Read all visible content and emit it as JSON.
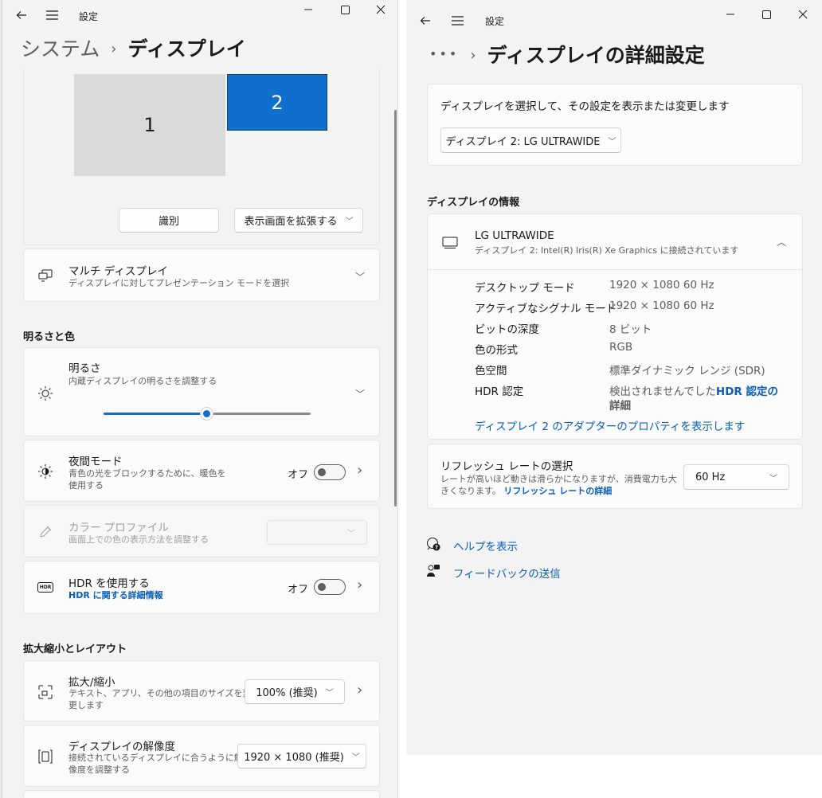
{
  "left": {
    "title": "設定",
    "breadcrumb": {
      "parent": "システム",
      "current": "ディスプレイ"
    },
    "monitors": {
      "m1": "1",
      "m2": "2"
    },
    "identify_button": "識別",
    "extend_select": "表示画面を拡張する",
    "multi_display": {
      "title": "マルチ ディスプレイ",
      "desc": "ディスプレイに対してプレゼンテーション モードを選択"
    },
    "section_brightness": "明るさと色",
    "brightness": {
      "title": "明るさ",
      "desc": "内蔵ディスプレイの明るさを調整する",
      "level_percent": 50
    },
    "night_mode": {
      "title": "夜間モード",
      "desc1": "青色の光をブロックするために、暖色を",
      "desc2": "使用する",
      "state": "オフ"
    },
    "color_profile": {
      "title": "カラー プロファイル",
      "desc": "画面上での色の表示方法を調整する"
    },
    "hdr": {
      "title": "HDR を使用する",
      "link": "HDR に関する詳細情報",
      "state": "オフ",
      "badge": "HDR"
    },
    "section_scale": "拡大縮小とレイアウト",
    "scale": {
      "title": "拡大/縮小",
      "desc1": "テキスト、アプリ、その他の項目のサイズを変",
      "desc2": "更します",
      "value": "100% (推奨)"
    },
    "resolution": {
      "title": "ディスプレイの解像度",
      "desc1": "接続されているディスプレイに合うように解",
      "desc2": "像度を調整する",
      "value": "1920 × 1080 (推奨)"
    }
  },
  "right": {
    "title": "設定",
    "breadcrumb": {
      "parent": "•••",
      "current": "ディスプレイの詳細設定"
    },
    "select_label": "ディスプレイを選択して、その設定を表示または変更します",
    "select_value": "ディスプレイ 2: LG ULTRAWIDE",
    "section_info": "ディスプレイの情報",
    "display": {
      "name": "LG ULTRAWIDE",
      "sub": "ディスプレイ 2: Intel(R) Iris(R) Xe Graphics に接続されています"
    },
    "info": [
      {
        "key": "デスクトップ モード",
        "value": "1920 × 1080 60 Hz"
      },
      {
        "key": "アクティブなシグナル モード",
        "value": "1920 × 1080 60 Hz"
      },
      {
        "key": "ビットの深度",
        "value": "8 ビット"
      },
      {
        "key": "色の形式",
        "value": "RGB"
      },
      {
        "key": "色空間",
        "value": "標準ダイナミック レンジ (SDR)"
      },
      {
        "key": "HDR 認定",
        "value": "検出されませんでした",
        "link1": "HDR 認定の",
        "link2": "詳細"
      }
    ],
    "adapter_link": "ディスプレイ 2 のアダプターのプロパティを表示します",
    "refresh": {
      "title": "リフレッシュ レートの選択",
      "desc1": "レートが高いほど動きは滑らかになりますが、消費電力も大",
      "desc2": "きくなります。",
      "link": "リフレッシュ レートの詳細",
      "value": "60 Hz"
    },
    "help": "ヘルプを表示",
    "feedback": "フィードバックの送信"
  }
}
